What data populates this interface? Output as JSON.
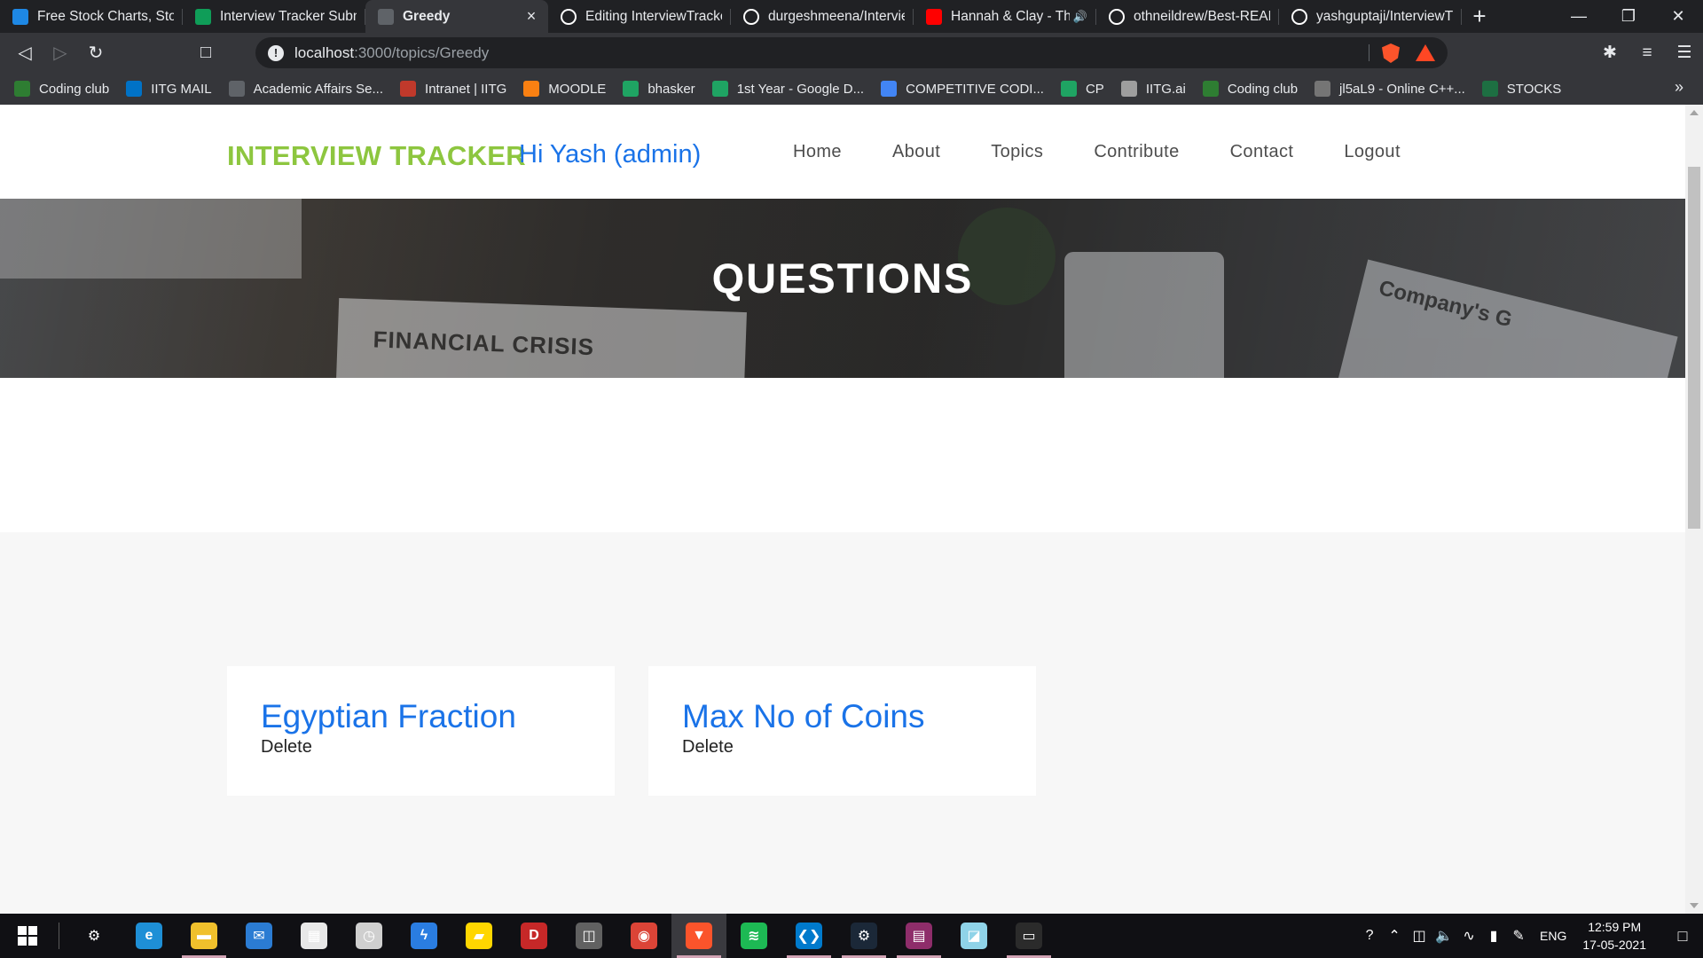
{
  "browser": {
    "tabs": [
      {
        "title": "Free Stock Charts, Stock",
        "icon": "chart-icon",
        "color": "#1e88e5"
      },
      {
        "title": "Interview Tracker Submi",
        "icon": "sheets-plus-icon",
        "color": "#0f9d58"
      },
      {
        "title": "Greedy",
        "icon": "globe-icon",
        "color": "#5f6368",
        "active": true
      },
      {
        "title": "Editing InterviewTracker",
        "icon": "github-icon",
        "color": "#ffffff"
      },
      {
        "title": "durgeshmeena/Intervie",
        "icon": "github-icon",
        "color": "#ffffff"
      },
      {
        "title": "Hannah & Clay - The",
        "icon": "youtube-icon",
        "color": "#ff0000",
        "audio": true
      },
      {
        "title": "othneildrew/Best-READ",
        "icon": "github-icon",
        "color": "#ffffff"
      },
      {
        "title": "yashguptaji/InterviewTra",
        "icon": "github-icon",
        "color": "#ffffff"
      }
    ],
    "url_host": "localhost",
    "url_path": ":3000/topics/Greedy",
    "bookmarks": [
      {
        "label": "Coding club",
        "icon": "coding-club-icon",
        "color": "#2e7d32"
      },
      {
        "label": "IITG MAIL",
        "icon": "outlook-icon",
        "color": "#0072c6"
      },
      {
        "label": "Academic Affairs Se...",
        "icon": "globe-icon",
        "color": "#5f6368"
      },
      {
        "label": "Intranet | IITG",
        "icon": "iitg-icon",
        "color": "#c0392b"
      },
      {
        "label": "MOODLE",
        "icon": "moodle-icon",
        "color": "#f98012"
      },
      {
        "label": "bhasker",
        "icon": "drive-icon",
        "color": "#1fa463"
      },
      {
        "label": "1st Year - Google D...",
        "icon": "drive-icon",
        "color": "#1fa463"
      },
      {
        "label": "COMPETITIVE CODI...",
        "icon": "docs-icon",
        "color": "#4285f4"
      },
      {
        "label": "CP",
        "icon": "drive-icon",
        "color": "#1fa463"
      },
      {
        "label": "IITG.ai",
        "icon": "brain-icon",
        "color": "#9e9e9e"
      },
      {
        "label": "Coding club",
        "icon": "coding-club-icon",
        "color": "#2e7d32"
      },
      {
        "label": "jl5aL9 - Online C++...",
        "icon": "ide-icon",
        "color": "#757575"
      },
      {
        "label": "STOCKS",
        "icon": "excel-icon",
        "color": "#1d6f42"
      }
    ]
  },
  "site": {
    "logo": "INTERVIEW TRACKER",
    "greeting": "Hi Yash (admin)",
    "nav": [
      "Home",
      "About",
      "Topics",
      "Contribute",
      "Contact",
      "Logout"
    ],
    "hero_title": "QUESTIONS",
    "hero_image_text_1": "FINANCIAL CRISIS",
    "hero_image_text_2": "Company's G",
    "questions": [
      {
        "title": "Egyptian Fraction",
        "action": "Delete"
      },
      {
        "title": "Max No of Coins",
        "action": "Delete"
      }
    ]
  },
  "taskbar": {
    "apps": [
      {
        "name": "settings",
        "icon": "gear-icon",
        "color": "#101014",
        "glyph": "⚙"
      },
      {
        "name": "edge",
        "icon": "edge-icon",
        "color": "#1e8fd6",
        "glyph": "e"
      },
      {
        "name": "file-explorer",
        "icon": "folder-icon",
        "color": "#f0c02c",
        "glyph": "▬",
        "open": true
      },
      {
        "name": "mail",
        "icon": "mail-icon",
        "color": "#2b7cd3",
        "glyph": "✉"
      },
      {
        "name": "store",
        "icon": "store-icon",
        "color": "#e8e8e8",
        "glyph": "▦"
      },
      {
        "name": "clock",
        "icon": "clock-icon",
        "color": "#cfcfcf",
        "glyph": "◷"
      },
      {
        "name": "app-blue",
        "icon": "bolt-icon",
        "color": "#2a7de1",
        "glyph": "ϟ"
      },
      {
        "name": "sticky-notes",
        "icon": "note-icon",
        "color": "#ffd600",
        "glyph": "▰"
      },
      {
        "name": "app-red",
        "icon": "red-app-icon",
        "color": "#c62828",
        "glyph": "D"
      },
      {
        "name": "app-gray",
        "icon": "gray-app-icon",
        "color": "#616161",
        "glyph": "◫"
      },
      {
        "name": "chrome",
        "icon": "chrome-icon",
        "color": "#db4437",
        "glyph": "◉"
      },
      {
        "name": "brave",
        "icon": "brave-icon",
        "color": "#fb542b",
        "glyph": "▼",
        "open": true,
        "active": true
      },
      {
        "name": "spotify",
        "icon": "spotify-icon",
        "color": "#1db954",
        "glyph": "≋"
      },
      {
        "name": "vscode",
        "icon": "vscode-icon",
        "color": "#007acc",
        "glyph": "❮❯",
        "open": true
      },
      {
        "name": "steam",
        "icon": "steam-icon",
        "color": "#1b2838",
        "glyph": "⚙",
        "open": true
      },
      {
        "name": "winrar",
        "icon": "winrar-icon",
        "color": "#8e2d6a",
        "glyph": "▤",
        "open": true
      },
      {
        "name": "app-sky",
        "icon": "sky-app-icon",
        "color": "#8fd3e8",
        "glyph": "◪"
      },
      {
        "name": "terminal",
        "icon": "terminal-icon",
        "color": "#2b2b2b",
        "glyph": "▭",
        "open": true
      }
    ],
    "language": "ENG",
    "time": "12:59 PM",
    "date": "17-05-2021"
  },
  "colors": {
    "logo": "#8dc63f",
    "accent": "#1a73e8",
    "content_bg": "#f7f7f7"
  }
}
